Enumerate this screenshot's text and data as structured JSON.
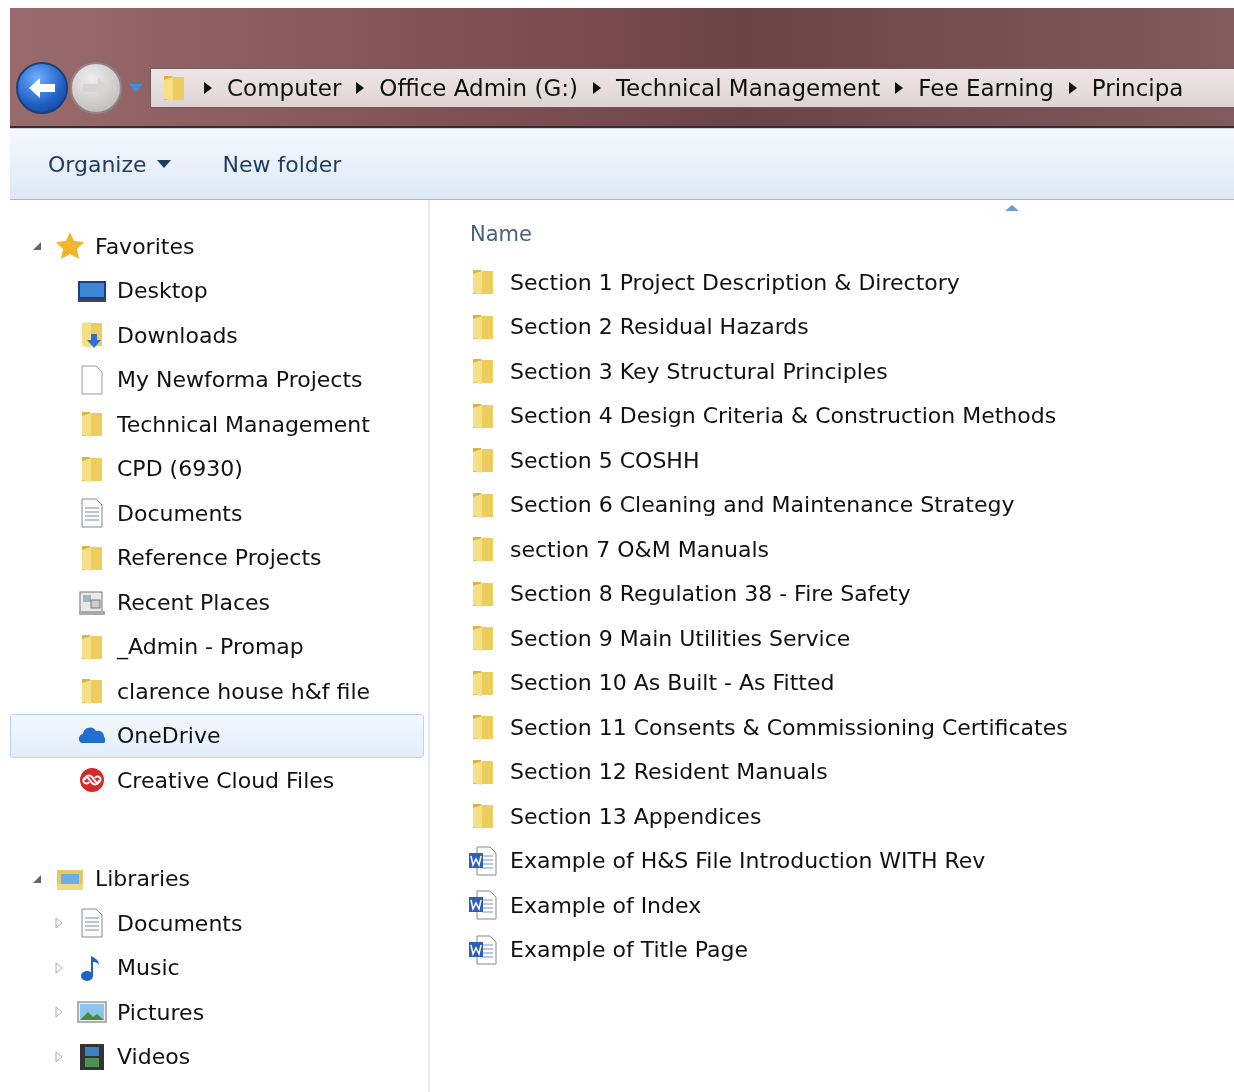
{
  "address": {
    "segments": [
      "Computer",
      "Office Admin (G:)",
      "Technical Management",
      "Fee Earning",
      "Principa"
    ]
  },
  "toolbar": {
    "buttons": [
      {
        "label": "Organize",
        "dropdown": true
      },
      {
        "label": "New folder",
        "dropdown": false
      }
    ]
  },
  "sidebar": {
    "groups": [
      {
        "label": "Favorites",
        "kind": "favorites",
        "expanded": true,
        "items": [
          {
            "label": "Desktop",
            "kind": "desktop",
            "selected": false
          },
          {
            "label": "Downloads",
            "kind": "downloads",
            "selected": false
          },
          {
            "label": "My Newforma Projects",
            "kind": "blank",
            "selected": false
          },
          {
            "label": "Technical Management",
            "kind": "folder",
            "selected": false
          },
          {
            "label": "CPD (6930)",
            "kind": "folder",
            "selected": false
          },
          {
            "label": "Documents",
            "kind": "document",
            "selected": false
          },
          {
            "label": "Reference Projects",
            "kind": "folder",
            "selected": false
          },
          {
            "label": "Recent Places",
            "kind": "recent",
            "selected": false
          },
          {
            "label": "_Admin - Promap",
            "kind": "folder",
            "selected": false
          },
          {
            "label": "clarence house h&f file",
            "kind": "folder",
            "selected": false
          },
          {
            "label": "OneDrive",
            "kind": "onedrive",
            "selected": true
          },
          {
            "label": "Creative Cloud Files",
            "kind": "creative",
            "selected": false
          }
        ]
      },
      {
        "label": "Libraries",
        "kind": "libraries",
        "expanded": true,
        "items": [
          {
            "label": "Documents",
            "kind": "document",
            "selected": false,
            "expanded": false
          },
          {
            "label": "Music",
            "kind": "music",
            "selected": false,
            "expanded": false
          },
          {
            "label": "Pictures",
            "kind": "pictures",
            "selected": false,
            "expanded": false
          },
          {
            "label": "Videos",
            "kind": "videos",
            "selected": false,
            "expanded": false
          }
        ]
      }
    ]
  },
  "file_list": {
    "columns": [
      {
        "label": "Name",
        "sorted": true
      }
    ],
    "items": [
      {
        "name": "Section 1 Project Description & Directory",
        "kind": "folder"
      },
      {
        "name": "Section 2 Residual Hazards",
        "kind": "folder"
      },
      {
        "name": "Section 3 Key Structural Principles",
        "kind": "folder"
      },
      {
        "name": "Section 4 Design Criteria & Construction Methods",
        "kind": "folder"
      },
      {
        "name": "Section 5 COSHH",
        "kind": "folder"
      },
      {
        "name": "Section 6 Cleaning and Maintenance Strategy",
        "kind": "folder"
      },
      {
        "name": "section 7 O&M Manuals",
        "kind": "folder"
      },
      {
        "name": "Section 8 Regulation 38 - Fire Safety",
        "kind": "folder"
      },
      {
        "name": "Section 9 Main Utilities Service",
        "kind": "folder"
      },
      {
        "name": "Section 10 As Built - As Fitted",
        "kind": "folder"
      },
      {
        "name": "Section 11 Consents & Commissioning Certificates",
        "kind": "folder"
      },
      {
        "name": "Section 12 Resident Manuals",
        "kind": "folder"
      },
      {
        "name": "Section 13 Appendices",
        "kind": "folder"
      },
      {
        "name": "Example of H&S File Introduction WITH Rev",
        "kind": "word"
      },
      {
        "name": "Example of Index",
        "kind": "word"
      },
      {
        "name": "Example of Title Page",
        "kind": "word"
      }
    ]
  }
}
